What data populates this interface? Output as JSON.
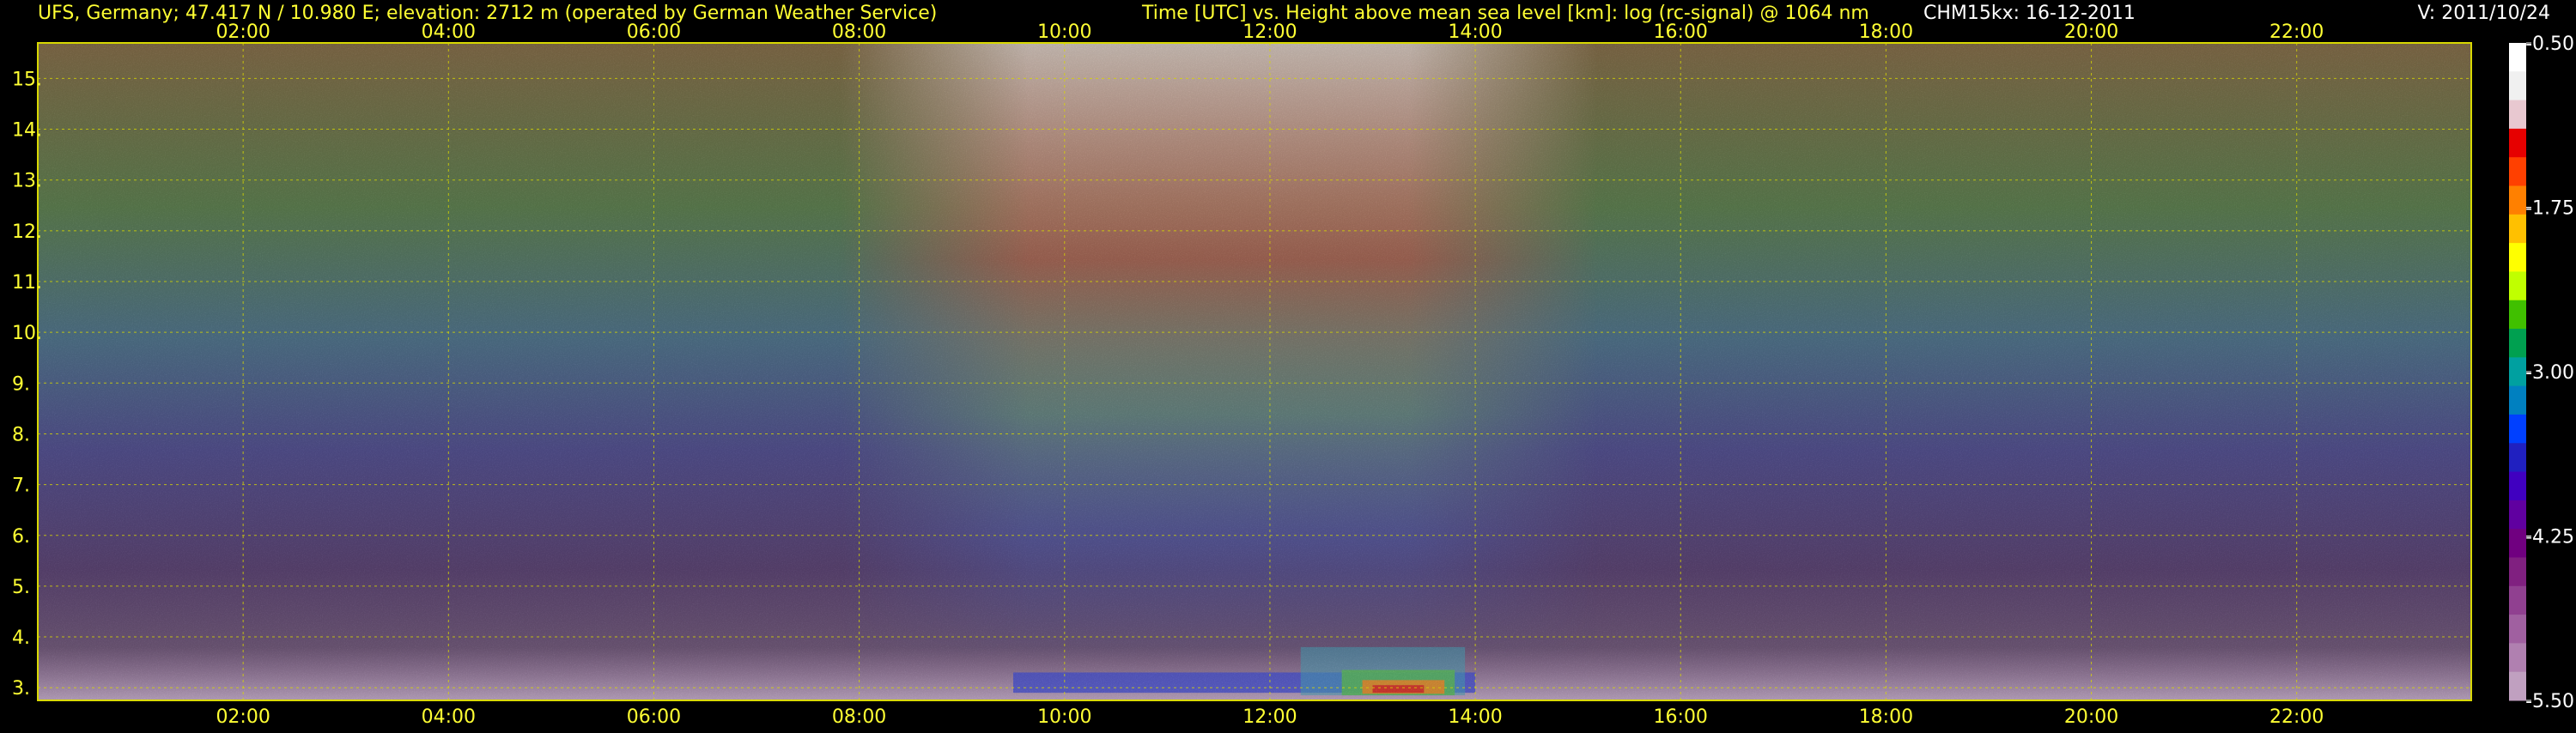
{
  "header": {
    "station": "UFS, Germany; 47.417 N / 10.980 E; elevation: 2712 m  (operated by German Weather Service)",
    "description": "Time [UTC] vs. Height above mean sea level [km]: log (rc-signal) @ 1064 nm",
    "instrument_date": "CHM15kx: 16-12-2011",
    "version": "V: 2011/10/24"
  },
  "colors": {
    "background": "#000000",
    "text": "#ffff33",
    "grid": "#d8d800",
    "frame": "#d8d800"
  },
  "chart_data": {
    "type": "heatmap",
    "title": "Time [UTC] vs. Height above mean sea level [km]: log (rc-signal) @ 1064 nm",
    "xlabel": "Time [UTC]",
    "ylabel": "Height above mean sea level [km]",
    "x_ticks": [
      "02:00",
      "04:00",
      "06:00",
      "08:00",
      "10:00",
      "12:00",
      "14:00",
      "16:00",
      "18:00",
      "20:00",
      "22:00"
    ],
    "x_tick_hours": [
      2,
      4,
      6,
      8,
      10,
      12,
      14,
      16,
      18,
      20,
      22
    ],
    "xlim_hours": [
      0,
      23.7
    ],
    "y_ticks": [
      "3.",
      "4.",
      "5.",
      "6.",
      "7.",
      "8.",
      "9.",
      "10.",
      "11.",
      "12.",
      "13.",
      "14.",
      "15."
    ],
    "y_tick_values": [
      3,
      4,
      5,
      6,
      7,
      8,
      9,
      10,
      11,
      12,
      13,
      14,
      15
    ],
    "ylim_km": [
      2.75,
      15.7
    ],
    "grid": true,
    "colorbar": {
      "label": "log (rc-signal)",
      "tick_labels": [
        "-0.50",
        "-1.75",
        "-3.00",
        "-4.25",
        "-5.50"
      ],
      "tick_values": [
        -0.5,
        -1.75,
        -3.0,
        -4.25,
        -5.5
      ],
      "range": [
        -5.5,
        -0.5
      ],
      "colors_top_to_bottom": [
        "#ffffff",
        "#f0f0f0",
        "#e8c8d0",
        "#e60000",
        "#ff4000",
        "#ff8000",
        "#ffc000",
        "#ffff00",
        "#c0ff00",
        "#40c000",
        "#00a050",
        "#00a0a0",
        "#0080c0",
        "#0040ff",
        "#2020c0",
        "#4000c0",
        "#6000a0",
        "#700080",
        "#802080",
        "#904090",
        "#a060a0",
        "#b080b0",
        "#c0a0c0"
      ]
    },
    "features": [
      {
        "label": "daytime background signal",
        "time_hours": [
          7.8,
          15.2
        ],
        "height_km": [
          3.5,
          15.7
        ]
      },
      {
        "label": "boundary layer aerosol",
        "time_hours": [
          9.5,
          14.0
        ],
        "height_km": [
          2.9,
          3.3
        ]
      },
      {
        "label": "strong signal near ground",
        "time_hours": [
          12.3,
          13.9
        ],
        "height_km": [
          2.85,
          3.8
        ]
      }
    ]
  }
}
